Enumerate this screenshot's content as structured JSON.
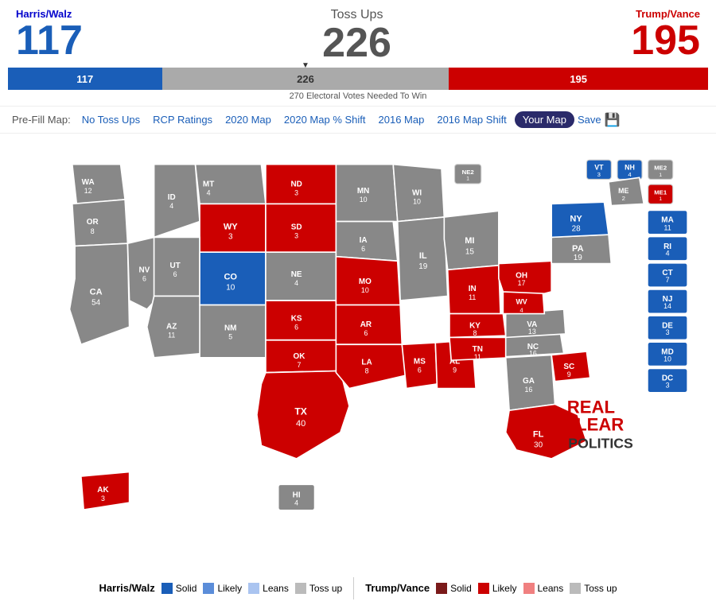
{
  "header": {
    "left_candidate": "Harris/Walz",
    "left_ev": "117",
    "center_label": "Toss Ups",
    "center_ev": "226",
    "right_candidate": "Trump/Vance",
    "right_ev": "195"
  },
  "progress_bar": {
    "blue_pct": 22,
    "gray_pct": 41,
    "red_pct": 37,
    "blue_label": "117",
    "gray_label": "226",
    "red_label": "195",
    "needed_text": "270 Electoral Votes Needed To Win"
  },
  "nav": {
    "prefix": "Pre-Fill Map:",
    "items": [
      {
        "label": "No Toss Ups",
        "active": false
      },
      {
        "label": "RCP Ratings",
        "active": false
      },
      {
        "label": "2020 Map",
        "active": false
      },
      {
        "label": "2020 Map % Shift",
        "active": false
      },
      {
        "label": "2016 Map",
        "active": false
      },
      {
        "label": "2016 Map Shift",
        "active": false
      },
      {
        "label": "Your Map",
        "active": true
      }
    ],
    "save_label": "Save"
  },
  "legend": {
    "harris_title": "Harris/Walz",
    "trump_title": "Trump/Vance",
    "items_harris": [
      {
        "label": "Solid",
        "color": "#1a5eb8"
      },
      {
        "label": "Likely",
        "color": "#5b8dd9"
      },
      {
        "label": "Leans",
        "color": "#aac4f0"
      },
      {
        "label": "Toss up",
        "color": "#bbbbbb"
      }
    ],
    "items_trump": [
      {
        "label": "Solid",
        "color": "#7a1a1a"
      },
      {
        "label": "Likely",
        "color": "#cc0000"
      },
      {
        "label": "Leans",
        "color": "#f08080"
      },
      {
        "label": "Toss up",
        "color": "#bbbbbb"
      }
    ]
  },
  "rcp_watermark": {
    "line1": "REAL",
    "line2": "CLEAR",
    "line3": "POLITICS"
  }
}
